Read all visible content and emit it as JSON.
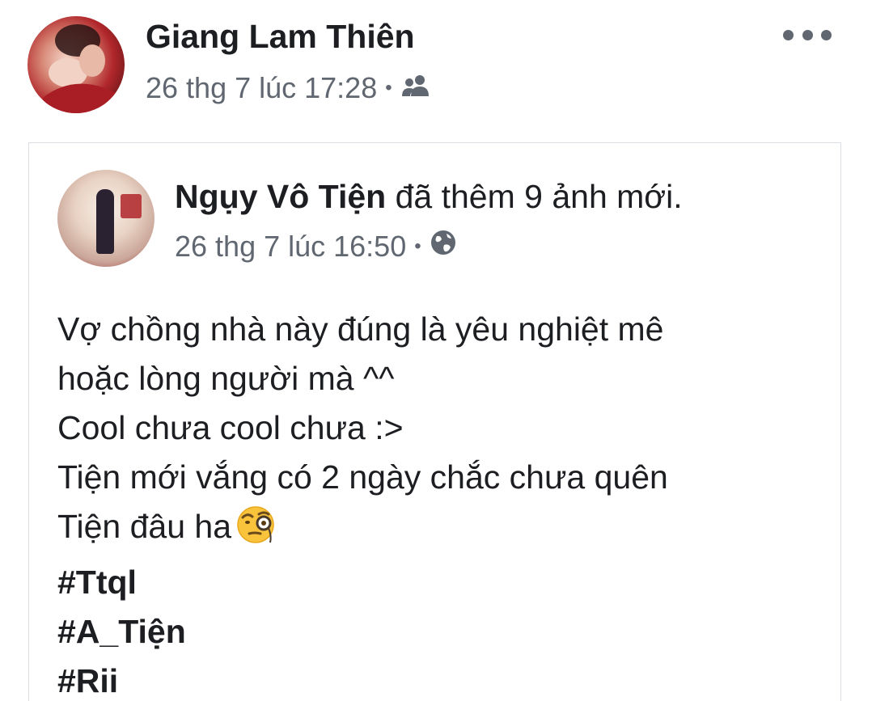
{
  "outer_post": {
    "author": "Giang Lam Thiên",
    "time": "26 thg 7 lúc 17:28",
    "separator": "•",
    "audience_icon": "friends-icon",
    "menu_icon": "more-options-icon"
  },
  "shared_post": {
    "author": "Ngụy Vô Tiện",
    "action": " đã thêm 9 ảnh mới.",
    "time": "26 thg 7 lúc 16:50",
    "separator": "•",
    "audience_icon": "globe-icon",
    "body_lines": [
      "Vợ chồng nhà này đúng là yêu nghiệt mê",
      "hoặc lòng người mà ^^",
      "Cool chưa cool chưa :>",
      "Tiện mới vắng có 2 ngày chắc chưa quên"
    ],
    "last_line": "Tiện đâu ha",
    "emoji": "face-with-monocle-emoji",
    "hashtags": [
      "#Ttql",
      "#A_Tiện",
      "#Rii"
    ]
  }
}
